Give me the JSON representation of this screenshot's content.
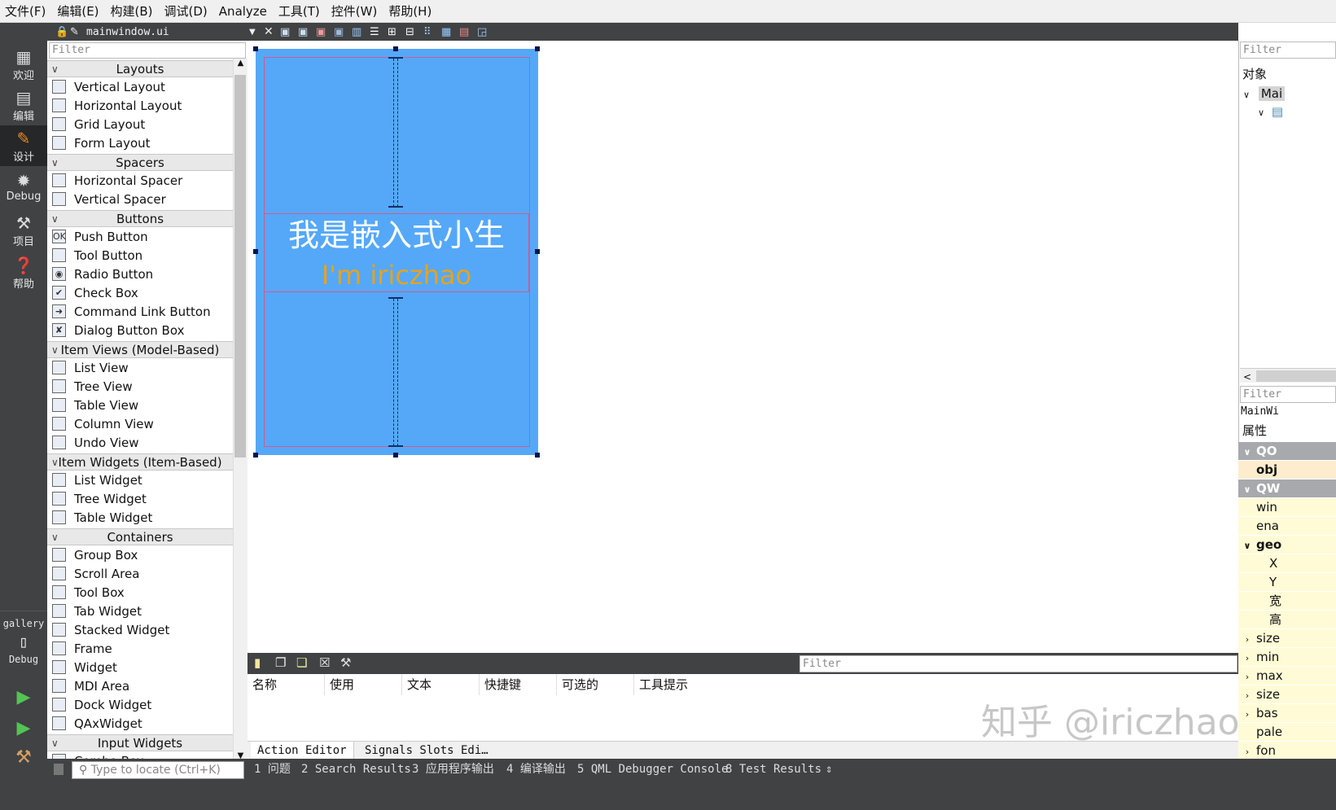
{
  "menubar": [
    "文件(F)",
    "编辑(E)",
    "构建(B)",
    "调试(D)",
    "Analyze",
    "工具(T)",
    "控件(W)",
    "帮助(H)"
  ],
  "modes": [
    {
      "label": "欢迎",
      "icon": "grid-icon"
    },
    {
      "label": "编辑",
      "icon": "document-icon"
    },
    {
      "label": "设计",
      "icon": "pencil-icon"
    },
    {
      "label": "Debug",
      "icon": "bug-icon"
    },
    {
      "label": "项目",
      "icon": "wrench-icon"
    },
    {
      "label": "帮助",
      "icon": "help-icon"
    }
  ],
  "kit": {
    "name": "gallery",
    "mode": "Debug"
  },
  "editor": {
    "file_name": "mainwindow.ui"
  },
  "widgetbox": {
    "filter_placeholder": "Filter",
    "categories": [
      {
        "name": "Layouts",
        "items": [
          "Vertical Layout",
          "Horizontal Layout",
          "Grid Layout",
          "Form Layout"
        ]
      },
      {
        "name": "Spacers",
        "items": [
          "Horizontal Spacer",
          "Vertical Spacer"
        ]
      },
      {
        "name": "Buttons",
        "items": [
          "Push Button",
          "Tool Button",
          "Radio Button",
          "Check Box",
          "Command Link Button",
          "Dialog Button Box"
        ]
      },
      {
        "name": "Item Views (Model-Based)",
        "items": [
          "List View",
          "Tree View",
          "Table View",
          "Column View",
          "Undo View"
        ]
      },
      {
        "name": "Item Widgets (Item-Based)",
        "items": [
          "List Widget",
          "Tree Widget",
          "Table Widget"
        ]
      },
      {
        "name": "Containers",
        "items": [
          "Group Box",
          "Scroll Area",
          "Tool Box",
          "Tab Widget",
          "Stacked Widget",
          "Frame",
          "Widget",
          "MDI Area",
          "Dock Widget",
          "QAxWidget"
        ]
      },
      {
        "name": "Input Widgets",
        "items": [
          "Combo Box"
        ]
      }
    ]
  },
  "form": {
    "label_cn": "我是嵌入式小生",
    "label_en": "I'm iriczhao",
    "label_cn_color": "#ffffff",
    "label_en_color": "#e8a21c",
    "background": "#55a8f8"
  },
  "object_inspector": {
    "filter_placeholder": "Filter",
    "header": "对象",
    "root": "Mai"
  },
  "property_editor": {
    "filter_placeholder": "Filter",
    "object": "MainWi",
    "header": "属性",
    "rows": [
      "QO",
      "obj",
      "QW",
      "win",
      "ena",
      "geo",
      "X",
      "Y",
      "宽",
      "高",
      "size",
      "min",
      "max",
      "size",
      "bas",
      "pale",
      "fon"
    ]
  },
  "action_editor": {
    "filter_placeholder": "Filter",
    "columns": [
      "名称",
      "使用",
      "文本",
      "快捷键",
      "可选的",
      "工具提示"
    ],
    "tabs": [
      "Action Editor",
      "Signals  Slots Edi…"
    ]
  },
  "statusbar": {
    "locator_placeholder": "Type to locate (Ctrl+K)",
    "tabs": [
      "1 问题",
      "2 Search Results",
      "3 应用程序输出",
      "4 编译输出",
      "5 QML Debugger Console",
      "8 Test Results"
    ]
  },
  "watermark": "知乎 @iriczhao"
}
